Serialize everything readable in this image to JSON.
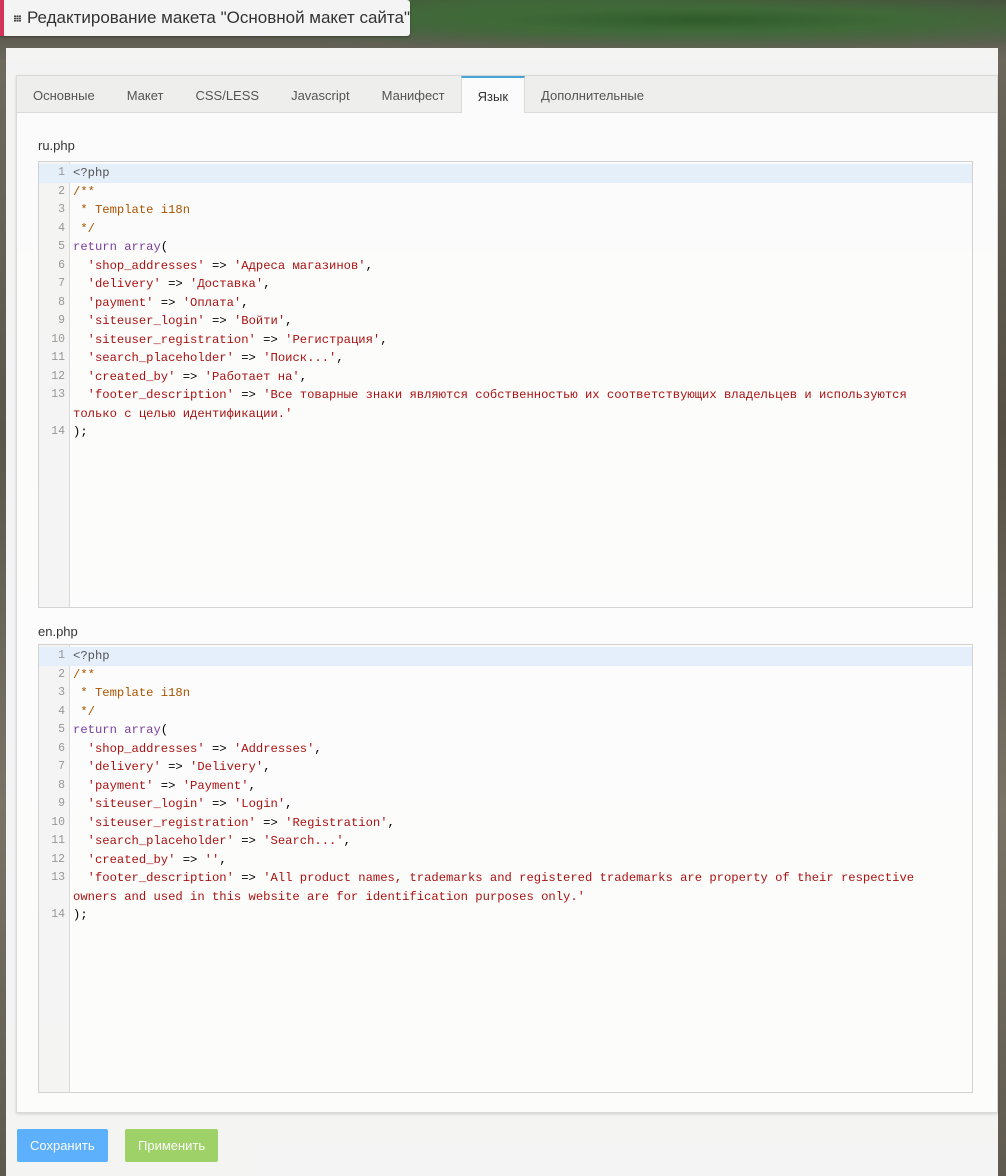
{
  "window": {
    "title": "Редактирование макета \"Основной макет сайта\""
  },
  "tabs": [
    {
      "label": "Основные"
    },
    {
      "label": "Макет"
    },
    {
      "label": "CSS/LESS"
    },
    {
      "label": "Javascript"
    },
    {
      "label": "Манифест"
    },
    {
      "label": "Язык",
      "active": true
    },
    {
      "label": "Дополнительные"
    }
  ],
  "editors": [
    {
      "filename": "ru.php",
      "lines": [
        {
          "n": "1",
          "text": "<?php"
        },
        {
          "n": "2",
          "text": "/**"
        },
        {
          "n": "3",
          "text": " * Template i18n"
        },
        {
          "n": "4",
          "text": " */"
        },
        {
          "n": "5",
          "text": "return array("
        },
        {
          "n": "6",
          "text": "  'shop_addresses' => 'Адреса магазинов',"
        },
        {
          "n": "7",
          "text": "  'delivery' => 'Доставка',"
        },
        {
          "n": "8",
          "text": "  'payment' => 'Оплата',"
        },
        {
          "n": "9",
          "text": "  'siteuser_login' => 'Войти',"
        },
        {
          "n": "10",
          "text": "  'siteuser_registration' => 'Регистрация',"
        },
        {
          "n": "11",
          "text": "  'search_placeholder' => 'Поиск...',"
        },
        {
          "n": "12",
          "text": "  'created_by' => 'Работает на',"
        },
        {
          "n": "13",
          "text": "  'footer_description' => 'Все товарные знаки являются собственностью их соответствующих владельцев и используются только с целью идентификации.'"
        },
        {
          "n": "14",
          "text": ");"
        }
      ]
    },
    {
      "filename": "en.php",
      "lines": [
        {
          "n": "1",
          "text": "<?php"
        },
        {
          "n": "2",
          "text": "/**"
        },
        {
          "n": "3",
          "text": " * Template i18n"
        },
        {
          "n": "4",
          "text": " */"
        },
        {
          "n": "5",
          "text": "return array("
        },
        {
          "n": "6",
          "text": "  'shop_addresses' => 'Addresses',"
        },
        {
          "n": "7",
          "text": "  'delivery' => 'Delivery',"
        },
        {
          "n": "8",
          "text": "  'payment' => 'Payment',"
        },
        {
          "n": "9",
          "text": "  'siteuser_login' => 'Login',"
        },
        {
          "n": "10",
          "text": "  'siteuser_registration' => 'Registration',"
        },
        {
          "n": "11",
          "text": "  'search_placeholder' => 'Search...',"
        },
        {
          "n": "12",
          "text": "  'created_by' => '',"
        },
        {
          "n": "13",
          "text": "  'footer_description' => 'All product names, trademarks and registered trademarks are property of their respective owners and used in this website are for identification purposes only.'"
        },
        {
          "n": "14",
          "text": ");"
        }
      ]
    }
  ],
  "buttons": {
    "save_label": "Сохранить",
    "apply_label": "Применить"
  },
  "colors": {
    "accent_tab": "#47a5d6",
    "title_marker": "#d2335b",
    "save_button": "#5db2ff",
    "apply_button": "#a0d468"
  }
}
